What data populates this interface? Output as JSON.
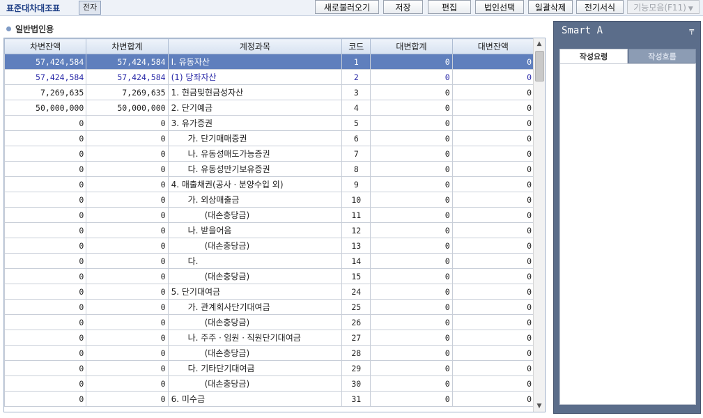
{
  "toolbar": {
    "title": "표준대차대조표",
    "tag": "전자",
    "buttons": [
      {
        "label": "새로불러오기",
        "disabled": false
      },
      {
        "label": "저장",
        "disabled": false
      },
      {
        "label": "편집",
        "disabled": false
      },
      {
        "label": "법인선택",
        "disabled": false
      },
      {
        "label": "일괄삭제",
        "disabled": false
      },
      {
        "label": "전기서식",
        "disabled": false
      },
      {
        "label": "기능모음(F11)",
        "disabled": true
      }
    ]
  },
  "section": {
    "title": "일반법인용"
  },
  "table": {
    "columns": [
      "차변잔액",
      "차변합계",
      "계정과목",
      "코드",
      "대변합계",
      "대변잔액"
    ],
    "rows": [
      {
        "debit_balance": "57,424,584",
        "debit_total": "57,424,584",
        "account": "Ⅰ. 유동자산",
        "code": "1",
        "credit_total": "0",
        "credit_balance": "0",
        "selected": true,
        "indent": 0
      },
      {
        "debit_balance": "57,424,584",
        "debit_total": "57,424,584",
        "account": "(1) 당좌자산",
        "code": "2",
        "credit_total": "0",
        "credit_balance": "0",
        "style": "blue",
        "indent": 0
      },
      {
        "debit_balance": "7,269,635",
        "debit_total": "7,269,635",
        "account": "1. 현금및현금성자산",
        "code": "3",
        "credit_total": "0",
        "credit_balance": "0",
        "indent": 1
      },
      {
        "debit_balance": "50,000,000",
        "debit_total": "50,000,000",
        "account": "2. 단기예금",
        "code": "4",
        "credit_total": "0",
        "credit_balance": "0",
        "indent": 1
      },
      {
        "debit_balance": "0",
        "debit_total": "0",
        "account": "3. 유가증권",
        "code": "5",
        "credit_total": "0",
        "credit_balance": "0",
        "indent": 1
      },
      {
        "debit_balance": "0",
        "debit_total": "0",
        "account": "가. 단기매매증권",
        "code": "6",
        "credit_total": "0",
        "credit_balance": "0",
        "indent": 2
      },
      {
        "debit_balance": "0",
        "debit_total": "0",
        "account": "나. 유동성매도가능증권",
        "code": "7",
        "credit_total": "0",
        "credit_balance": "0",
        "indent": 2
      },
      {
        "debit_balance": "0",
        "debit_total": "0",
        "account": "다. 유동성만기보유증권",
        "code": "8",
        "credit_total": "0",
        "credit_balance": "0",
        "indent": 2
      },
      {
        "debit_balance": "0",
        "debit_total": "0",
        "account": "4. 매출채권(공사ㆍ분양수입 외)",
        "code": "9",
        "credit_total": "0",
        "credit_balance": "0",
        "indent": 1
      },
      {
        "debit_balance": "0",
        "debit_total": "0",
        "account": "가. 외상매출금",
        "code": "10",
        "credit_total": "0",
        "credit_balance": "0",
        "indent": 2
      },
      {
        "debit_balance": "0",
        "debit_total": "0",
        "account": "(대손충당금)",
        "code": "11",
        "credit_total": "0",
        "credit_balance": "0",
        "indent": 3
      },
      {
        "debit_balance": "0",
        "debit_total": "0",
        "account": "나. 받을어음",
        "code": "12",
        "credit_total": "0",
        "credit_balance": "0",
        "indent": 2
      },
      {
        "debit_balance": "0",
        "debit_total": "0",
        "account": "(대손충당금)",
        "code": "13",
        "credit_total": "0",
        "credit_balance": "0",
        "indent": 3
      },
      {
        "debit_balance": "0",
        "debit_total": "0",
        "account": "다.",
        "code": "14",
        "credit_total": "0",
        "credit_balance": "0",
        "indent": 2
      },
      {
        "debit_balance": "0",
        "debit_total": "0",
        "account": "(대손충당금)",
        "code": "15",
        "credit_total": "0",
        "credit_balance": "0",
        "indent": 3
      },
      {
        "debit_balance": "0",
        "debit_total": "0",
        "account": "5. 단기대여금",
        "code": "24",
        "credit_total": "0",
        "credit_balance": "0",
        "indent": 1
      },
      {
        "debit_balance": "0",
        "debit_total": "0",
        "account": "가. 관계회사단기대여금",
        "code": "25",
        "credit_total": "0",
        "credit_balance": "0",
        "indent": 2
      },
      {
        "debit_balance": "0",
        "debit_total": "0",
        "account": "(대손충당금)",
        "code": "26",
        "credit_total": "0",
        "credit_balance": "0",
        "indent": 3
      },
      {
        "debit_balance": "0",
        "debit_total": "0",
        "account": "나. 주주ㆍ임원ㆍ직원단기대여금",
        "code": "27",
        "credit_total": "0",
        "credit_balance": "0",
        "indent": 2
      },
      {
        "debit_balance": "0",
        "debit_total": "0",
        "account": "(대손충당금)",
        "code": "28",
        "credit_total": "0",
        "credit_balance": "0",
        "indent": 3
      },
      {
        "debit_balance": "0",
        "debit_total": "0",
        "account": "다. 기타단기대여금",
        "code": "29",
        "credit_total": "0",
        "credit_balance": "0",
        "indent": 2
      },
      {
        "debit_balance": "0",
        "debit_total": "0",
        "account": "(대손충당금)",
        "code": "30",
        "credit_total": "0",
        "credit_balance": "0",
        "indent": 3
      },
      {
        "debit_balance": "0",
        "debit_total": "0",
        "account": "6. 미수금",
        "code": "31",
        "credit_total": "0",
        "credit_balance": "0",
        "indent": 1
      }
    ]
  },
  "smart_panel": {
    "title": "Smart A",
    "pin_icon": "pin-icon",
    "tabs": [
      {
        "label": "작성요령",
        "active": true
      },
      {
        "label": "작성흐름",
        "active": false
      }
    ]
  },
  "colors": {
    "selected_row": "#5f7fbd",
    "blue_text": "#2a2aa8",
    "panel_bg": "#5b6d8a"
  }
}
